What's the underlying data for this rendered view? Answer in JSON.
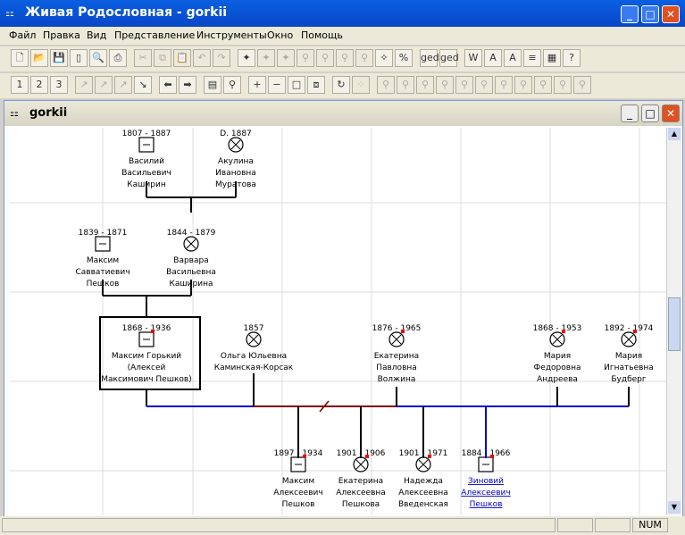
{
  "window": {
    "title": "Живая Родословная - gorkii"
  },
  "menu": [
    "Файл",
    "Правка",
    "Вид",
    "Представление",
    "Инструменты",
    "Окно",
    "Помощь"
  ],
  "child_window": {
    "title": "gorkii"
  },
  "status": {
    "num": "NUM"
  },
  "persons": [
    {
      "id": "vasily",
      "dates": "1807 - 1887",
      "sex": "male",
      "lines": [
        "Василий",
        "Васильевич",
        "Каширин"
      ]
    },
    {
      "id": "akulina",
      "dates": "D. 1887",
      "sex": "female",
      "lines": [
        "Акулина",
        "Ивановна",
        "Муратова"
      ]
    },
    {
      "id": "maksim-s",
      "dates": "1839 - 1871",
      "sex": "male",
      "lines": [
        "Максим",
        "Савватиевич",
        "Пешков"
      ]
    },
    {
      "id": "varvara",
      "dates": "1844 - 1879",
      "sex": "female",
      "lines": [
        "Варвара",
        "Васильевна",
        "Каширина"
      ]
    },
    {
      "id": "gorky",
      "dates": "1868 - 1936",
      "sex": "male",
      "lines": [
        "Максим Горький",
        "(Алексей",
        "Максимович Пешков)"
      ]
    },
    {
      "id": "olga",
      "dates": "1857",
      "sex": "female",
      "lines": [
        "Ольга Юльевна",
        "Каминская-Корсак"
      ]
    },
    {
      "id": "ekaterina-v",
      "dates": "1876 - 1965",
      "sex": "female",
      "lines": [
        "Екатерина",
        "Павловна",
        "Волжина"
      ]
    },
    {
      "id": "maria-a",
      "dates": "1868 - 1953",
      "sex": "female",
      "lines": [
        "Мария",
        "Федоровна",
        "Андреева"
      ]
    },
    {
      "id": "maria-b",
      "dates": "1892 - 1974",
      "sex": "female",
      "lines": [
        "Мария",
        "Игнатьевна",
        "Будберг"
      ]
    },
    {
      "id": "maksim-a",
      "dates": "1897 - 1934",
      "sex": "male",
      "lines": [
        "Максим",
        "Алексеевич",
        "Пешков"
      ]
    },
    {
      "id": "ekaterina-a",
      "dates": "1901 - 1906",
      "sex": "female",
      "lines": [
        "Екатерина",
        "Алексеевна",
        "Пешкова"
      ]
    },
    {
      "id": "nadezhda",
      "dates": "1901 - 1971",
      "sex": "female",
      "lines": [
        "Надежда",
        "Алексеевна",
        "Введенская"
      ]
    },
    {
      "id": "zinovy",
      "dates": "1884 - 1966",
      "sex": "male",
      "link": true,
      "lines": [
        "Зиновий",
        "Алексеевич",
        "Пешков"
      ]
    }
  ],
  "toolbar": {
    "row1": [
      "new-file",
      "open-folder",
      "save",
      "page",
      "print-preview",
      "print",
      "cut",
      "copy",
      "paste",
      "undo",
      "redo",
      "add-person",
      "add-female",
      "add-male",
      "add-parents",
      "add-spouse",
      "add-child",
      "add-sibling",
      "magic",
      "format",
      "ged-export",
      "ged-html",
      "web",
      "font-bigger",
      "font-smaller",
      "layers",
      "grid",
      "help"
    ],
    "row2": [
      "gen-1",
      "gen-2",
      "gen-3",
      "nav-1",
      "nav-2",
      "nav-3",
      "go",
      "back",
      "forward",
      "doc",
      "find",
      "zoom-in",
      "zoom-out",
      "zoom-fit",
      "zoom-page",
      "refresh",
      "link",
      "t1",
      "t2",
      "t3",
      "t4",
      "t5",
      "t6",
      "t7",
      "t8",
      "t9",
      "t10",
      "t11"
    ]
  },
  "toolbar_labels": {
    "ged": "ged",
    "gedhtml": "ged html"
  }
}
